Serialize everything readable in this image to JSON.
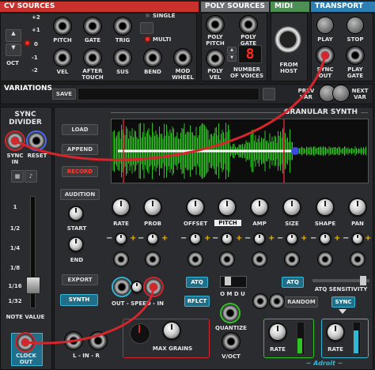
{
  "colors": {
    "cv": "#c8312c",
    "poly": "#6f7376",
    "midi": "#4d8f55",
    "transport": "#2e7fb3",
    "accent_cyan": "#33b7d6",
    "cable": "#d4262c"
  },
  "headers": {
    "cv": "CV SOURCES",
    "poly": "POLY SOURCES",
    "midi": "MIDI",
    "transport": "TRANSPORT",
    "variations": "VARIATIONS",
    "synth": "GRANULAR SYNTH"
  },
  "octave": {
    "label": "OCT",
    "values": [
      "+2",
      "+1",
      "0",
      "-1",
      "-2"
    ]
  },
  "cv": {
    "pitch": "PITCH",
    "gate": "GATE",
    "trig": "TRIG",
    "single": "SINGLE",
    "multi": "MULTI",
    "vel": "VEL",
    "aftertouch": "AFTER\nTOUCH",
    "sus": "SUS",
    "bend": "BEND",
    "modwheel": "MOD\nWHEEL"
  },
  "poly": {
    "pitch": "POLY\nPITCH",
    "gate": "POLY\nGATE",
    "vel": "POLY\nVEL",
    "voices": "NUMBER\nOF VOICES",
    "voices_value": "8"
  },
  "midi": {
    "from_host": "FROM\nHOST"
  },
  "transport": {
    "play": "PLAY",
    "stop": "STOP",
    "sync_out": "SYNC\nOUT",
    "play_gate": "PLAY\nGATE"
  },
  "variations": {
    "save": "SAVE",
    "prev": "PREV\nVAR",
    "next": "NEXT\nVAR"
  },
  "sync_divider": {
    "title": "SYNC\nDIVIDER",
    "sync_in": "SYNC\nIN",
    "reset": "RESET",
    "note_value": "NOTE VALUE",
    "divisions": [
      "1",
      "1/2",
      "1/4",
      "1/8",
      "1/16",
      "1/32"
    ],
    "clock_out": "CLOCK\nOUT"
  },
  "buttons": {
    "load": "LOAD",
    "append": "APPEND",
    "record": "RECORD",
    "audition": "AUDITION",
    "export": "EXPORT",
    "synth": "SYNTH",
    "atq1": "ATQ",
    "atq2": "ATQ",
    "rflct": "RFLCT",
    "random": "RANDOM",
    "sync": "SYNC"
  },
  "params": {
    "rate": "RATE",
    "prob": "PROB",
    "offset": "OFFSET",
    "pitch": "PITCH",
    "amp": "AMP",
    "size": "SIZE",
    "shape": "SHAPE",
    "pan": "PAN"
  },
  "labels": {
    "start": "START",
    "end": "END",
    "out_speed_in": "OUT - SPEED - IN",
    "omdu": "O M D U",
    "atq_sens": "ATQ SENSITIVITY",
    "max_grains": "MAX GRAINS",
    "quantize": "QUANTIZE",
    "voct": "V/OCT",
    "lnr": "L - IN - R",
    "rate1": "RATE",
    "rate2": "RATE",
    "adroit": "~ Adroit ~"
  }
}
